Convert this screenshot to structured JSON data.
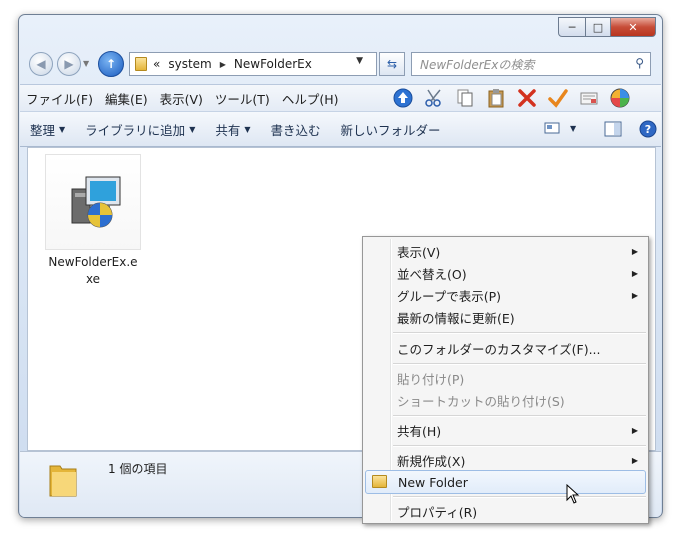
{
  "window": {
    "caption_buttons": {
      "minimize": "─",
      "maximize": "□",
      "close": "✕"
    }
  },
  "nav": {
    "breadcrumb_prefix": "«",
    "path": [
      "system",
      "NewFolderEx"
    ],
    "search_placeholder": "NewFolderExの検索"
  },
  "menubar": {
    "items": [
      "ファイル(F)",
      "編集(E)",
      "表示(V)",
      "ツール(T)",
      "ヘルプ(H)"
    ],
    "toolbar_icons": [
      "up-icon",
      "cut-icon",
      "copy-icon",
      "paste-icon",
      "delete-icon",
      "checkmark-icon",
      "properties-icon",
      "colorwheel-icon"
    ]
  },
  "commandbar": {
    "items": [
      "整理",
      "ライブラリに追加",
      "共有",
      "書き込む",
      "新しいフォルダー"
    ]
  },
  "content": {
    "files": [
      {
        "name": "NewFolderEx.exe"
      }
    ]
  },
  "details": {
    "count": "1 個の項目"
  },
  "context_menu": {
    "view": "表示(V)",
    "sort": "並べ替え(O)",
    "group": "グループで表示(P)",
    "refresh": "最新の情報に更新(E)",
    "customize": "このフォルダーのカスタマイズ(F)...",
    "paste": "貼り付け(P)",
    "paste_shortcut": "ショートカットの貼り付け(S)",
    "share": "共有(H)",
    "new": "新規作成(X)",
    "new_folder": "New Folder",
    "properties": "プロパティ(R)"
  }
}
